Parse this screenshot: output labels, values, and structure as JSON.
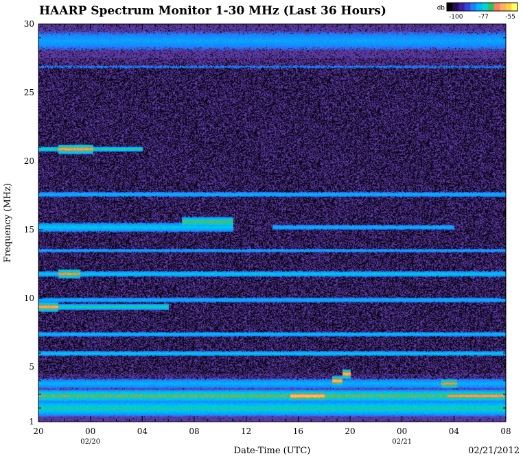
{
  "chart_data": {
    "type": "heatmap",
    "title": "HAARP Spectrum Monitor 1-30 MHz (Last 36 Hours)",
    "xlabel": "Date-Time (UTC)",
    "ylabel": "Frequency (MHz)",
    "date_stamp": "02/21/2012",
    "ylim": [
      1,
      30
    ],
    "y_ticks": [
      1,
      5,
      10,
      15,
      20,
      25,
      30
    ],
    "x_tick_labels": [
      "20",
      "00",
      "04",
      "08",
      "12",
      "16",
      "20",
      "00",
      "04",
      "08"
    ],
    "x_date_labels": [
      {
        "after_tick": "00",
        "index": 1,
        "label": "02/20"
      },
      {
        "after_tick": "00",
        "index": 7,
        "label": "02/21"
      }
    ],
    "colorbar": {
      "unit": "db",
      "labels": [
        "-100",
        "-77",
        "-55"
      ],
      "colors": [
        "#000000",
        "#2a0a5e",
        "#3b1fa3",
        "#2f45e0",
        "#1e80ff",
        "#00b4ff",
        "#00d4d4",
        "#30c060",
        "#ff8060",
        "#ffb060",
        "#ffd040",
        "#ffff60"
      ]
    },
    "background_level_color": "#5a3aa0",
    "noise_color": "#0a0418",
    "bands": [
      {
        "freq": 2.0,
        "start_h": 0,
        "end_h": 36,
        "intensity": 0.55,
        "width": 0.8
      },
      {
        "freq": 2.9,
        "start_h": 0,
        "end_h": 36,
        "intensity": 0.7,
        "width": 0.6
      },
      {
        "freq": 3.8,
        "start_h": 0,
        "end_h": 36,
        "intensity": 0.35,
        "width": 0.6
      },
      {
        "freq": 6.0,
        "start_h": 0,
        "end_h": 36,
        "intensity": 0.45,
        "width": 0.25
      },
      {
        "freq": 7.4,
        "start_h": 0,
        "end_h": 36,
        "intensity": 0.4,
        "width": 0.25
      },
      {
        "freq": 9.4,
        "start_h": 0,
        "end_h": 10,
        "intensity": 0.6,
        "width": 0.3
      },
      {
        "freq": 9.9,
        "start_h": 0,
        "end_h": 36,
        "intensity": 0.35,
        "width": 0.3
      },
      {
        "freq": 11.8,
        "start_h": 0,
        "end_h": 36,
        "intensity": 0.45,
        "width": 0.3
      },
      {
        "freq": 13.5,
        "start_h": 0,
        "end_h": 36,
        "intensity": 0.3,
        "width": 0.25
      },
      {
        "freq": 15.2,
        "start_h": 0,
        "end_h": 15,
        "intensity": 0.45,
        "width": 0.5
      },
      {
        "freq": 15.2,
        "start_h": 18,
        "end_h": 32,
        "intensity": 0.35,
        "width": 0.3
      },
      {
        "freq": 17.6,
        "start_h": 0,
        "end_h": 36,
        "intensity": 0.35,
        "width": 0.3
      },
      {
        "freq": 20.9,
        "start_h": 0,
        "end_h": 8,
        "intensity": 0.6,
        "width": 0.25
      },
      {
        "freq": 26.9,
        "start_h": 0,
        "end_h": 36,
        "intensity": 0.2,
        "width": 0.3
      },
      {
        "freq": 28.8,
        "start_h": 0,
        "end_h": 36,
        "intensity": 0.3,
        "width": 1.2
      }
    ],
    "hot_spots": [
      {
        "freq": 2.9,
        "start_h": 19.4,
        "end_h": 22,
        "intensity": 1.0
      },
      {
        "freq": 4.0,
        "start_h": 22.6,
        "end_h": 23.4,
        "intensity": 0.95
      },
      {
        "freq": 4.5,
        "start_h": 23.4,
        "end_h": 24.0,
        "intensity": 0.95
      },
      {
        "freq": 2.9,
        "start_h": 31.5,
        "end_h": 35.8,
        "intensity": 0.85
      },
      {
        "freq": 3.8,
        "start_h": 31.0,
        "end_h": 32.2,
        "intensity": 0.8
      },
      {
        "freq": 9.4,
        "start_h": 0,
        "end_h": 1.5,
        "intensity": 0.9
      },
      {
        "freq": 20.9,
        "start_h": 1.5,
        "end_h": 4.2,
        "intensity": 0.85
      },
      {
        "freq": 11.8,
        "start_h": 1.5,
        "end_h": 3.2,
        "intensity": 0.8
      },
      {
        "freq": 15.6,
        "start_h": 11,
        "end_h": 15,
        "intensity": 0.65
      }
    ]
  }
}
